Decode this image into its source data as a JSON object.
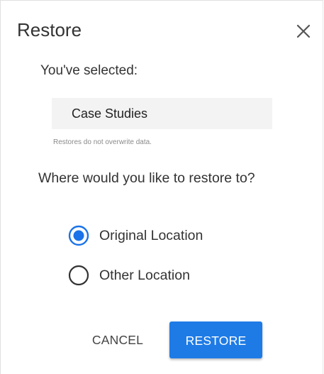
{
  "dialog": {
    "title": "Restore",
    "close_icon": "close-icon",
    "selected_label": "You've selected:",
    "selected_item": "Case Studies",
    "note": "Restores do not overwrite data.",
    "question": "Where would you like to restore to?",
    "options": [
      {
        "label": "Original Location",
        "selected": true
      },
      {
        "label": "Other Location",
        "selected": false
      }
    ],
    "cancel_label": "CANCEL",
    "restore_label": "RESTORE",
    "colors": {
      "accent": "#1e7be6",
      "radio_selected": "#1a73e8",
      "text": "#333333"
    }
  }
}
